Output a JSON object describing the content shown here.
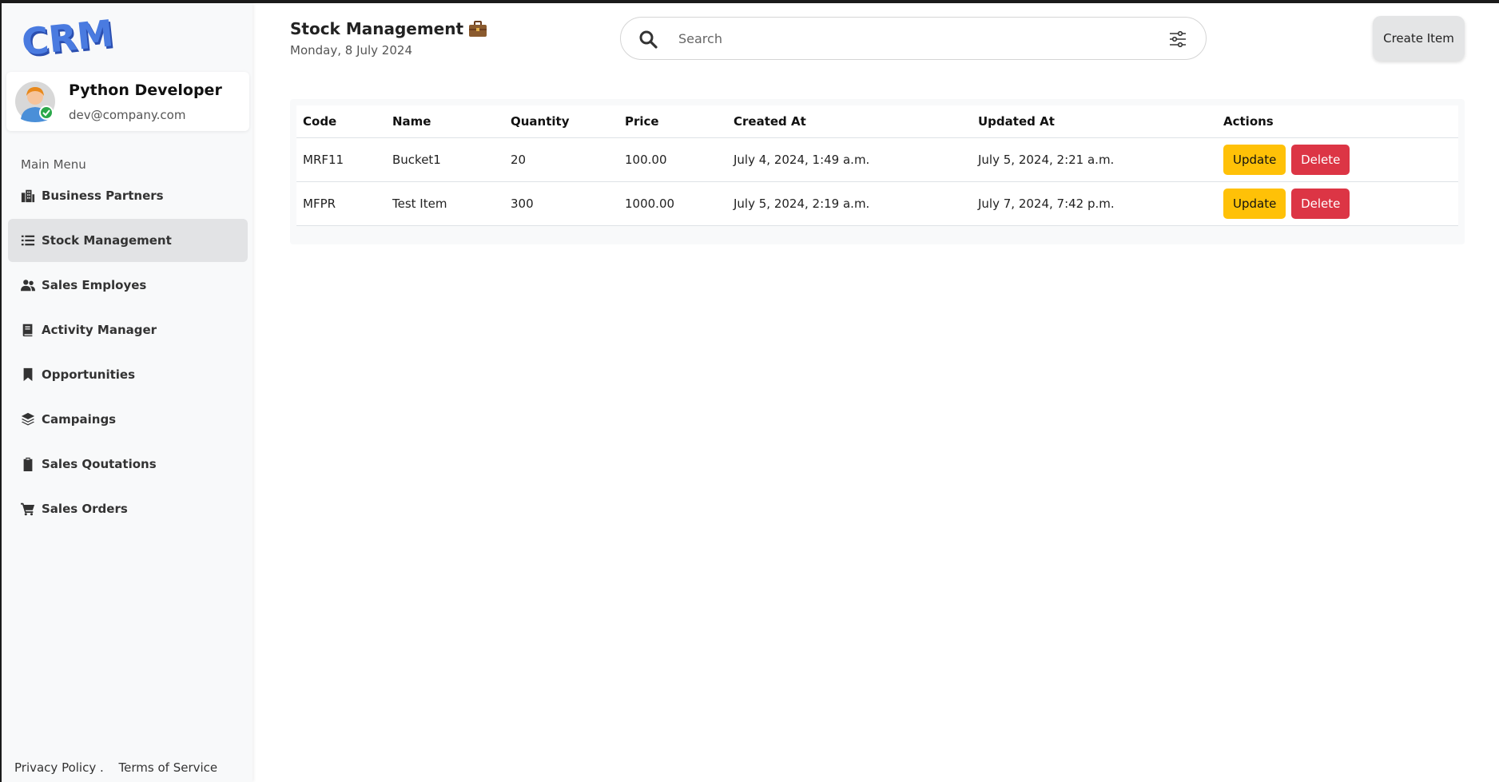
{
  "sidebar": {
    "logo_text": "CRM",
    "profile": {
      "name": "Python Developer",
      "email": "dev@company.com"
    },
    "menu_label": "Main Menu",
    "items": [
      {
        "label": "Business Partners",
        "icon": "building-icon"
      },
      {
        "label": "Stock Management",
        "icon": "list-icon",
        "active": true
      },
      {
        "label": "Sales Employes",
        "icon": "users-icon"
      },
      {
        "label": "Activity Manager",
        "icon": "book-icon"
      },
      {
        "label": "Opportunities",
        "icon": "bookmark-icon"
      },
      {
        "label": "Campaings",
        "icon": "layers-icon"
      },
      {
        "label": "Sales Qoutations",
        "icon": "clipboard-icon"
      },
      {
        "label": "Sales Orders",
        "icon": "cart-icon"
      }
    ],
    "footer": {
      "privacy": "Privacy Policy .",
      "terms": "Terms of Service"
    }
  },
  "header": {
    "title": "Stock Management",
    "title_icon": "briefcase-icon",
    "date": "Monday, 8 July 2024",
    "search_placeholder": "Search",
    "create_label": "Create Item"
  },
  "table": {
    "columns": [
      "Code",
      "Name",
      "Quantity",
      "Price",
      "Created At",
      "Updated At",
      "Actions"
    ],
    "rows": [
      {
        "code": "MRF11",
        "name": "Bucket1",
        "quantity": "20",
        "price": "100.00",
        "created": "July 4, 2024, 1:49 a.m.",
        "updated": "July 5, 2024, 2:21 a.m."
      },
      {
        "code": "MFPR",
        "name": "Test Item",
        "quantity": "300",
        "price": "1000.00",
        "created": "July 5, 2024, 2:19 a.m.",
        "updated": "July 7, 2024, 7:42 p.m."
      }
    ],
    "update_label": "Update",
    "delete_label": "Delete"
  },
  "colors": {
    "update": "#ffc107",
    "delete": "#dc3545",
    "sidebar_bg": "#f8f9fa",
    "logo_blue": "#3d6fd6"
  }
}
